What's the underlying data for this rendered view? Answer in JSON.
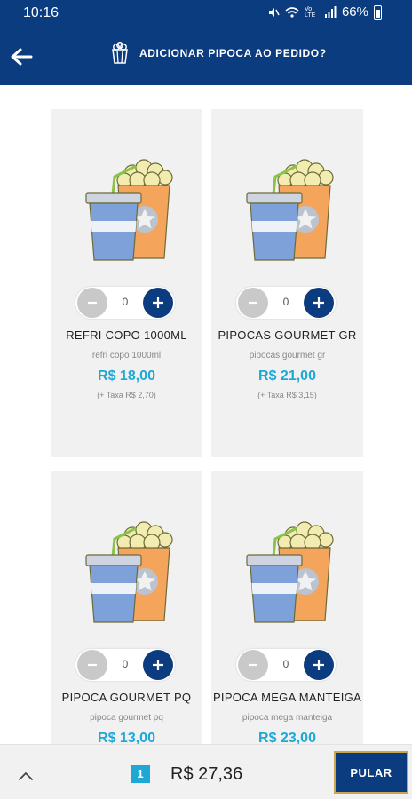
{
  "status": {
    "time": "10:16",
    "battery": "66%",
    "signal_text": "Vo LTE"
  },
  "header": {
    "title": "ADICIONAR PIPOCA AO PEDIDO?",
    "back_icon": "arrow-left-icon",
    "popcorn_icon": "popcorn-icon"
  },
  "products": [
    {
      "name": "REFRI COPO 1000ML",
      "description": "refri copo 1000ml",
      "price": "R$ 18,00",
      "tax": "(+ Taxa R$ 2,70)",
      "quantity": "0"
    },
    {
      "name": "PIPOCAS GOURMET GR",
      "description": "pipocas gourmet gr",
      "price": "R$ 21,00",
      "tax": "(+ Taxa R$ 3,15)",
      "quantity": "0"
    },
    {
      "name": "PIPOCA GOURMET PQ",
      "description": "pipoca gourmet pq",
      "price": "R$ 13,00",
      "tax": "",
      "quantity": "0"
    },
    {
      "name": "PIPOCA MEGA MANTEIGA",
      "description": "pipoca mega manteiga",
      "price": "R$ 23,00",
      "tax": "",
      "quantity": "0"
    }
  ],
  "footer": {
    "cart_count": "1",
    "total": "R$ 27,36",
    "skip_label": "PULAR"
  },
  "colors": {
    "primary": "#0b3c80",
    "accent": "#1ea8d6",
    "card_bg": "#f1f1f1",
    "skip_border": "#c9a550"
  }
}
